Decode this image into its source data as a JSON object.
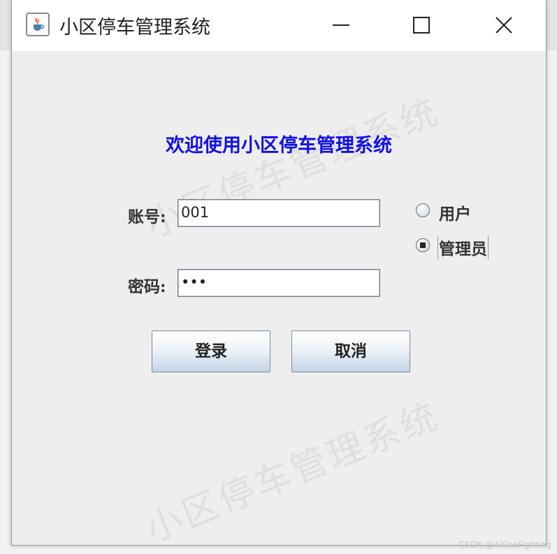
{
  "window": {
    "title": "小区停车管理系统",
    "icon": "java-cup-icon",
    "controls": [
      "minimize-icon",
      "maximize-icon",
      "close-icon"
    ]
  },
  "watermark": {
    "text": "小区停车管理系统",
    "color": "#787878"
  },
  "form": {
    "welcome": "欢迎使用小区停车管理系统",
    "welcome_color": "#1010e6",
    "account_label": "账号:",
    "account_value": "001",
    "password_label": "密码:",
    "password_value": "•••",
    "roles": [
      {
        "label": "用户",
        "selected": false
      },
      {
        "label": "管理员",
        "selected": true
      }
    ],
    "login_label": "登录",
    "cancel_label": "取消"
  },
  "credit": "CSDN @AXiaoFighting"
}
